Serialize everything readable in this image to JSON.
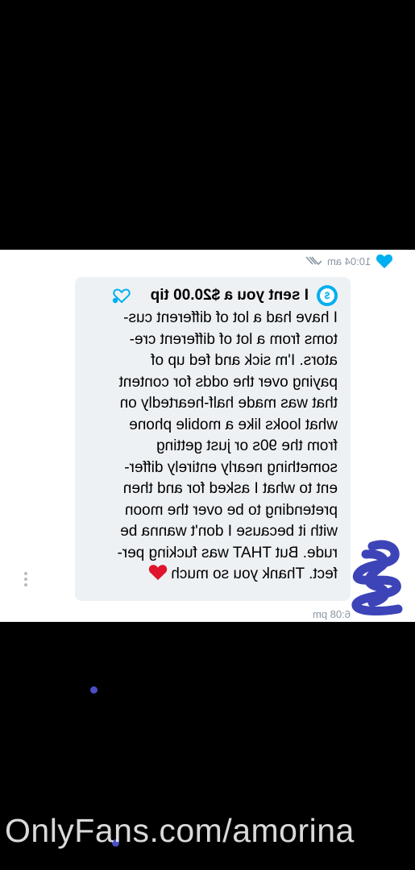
{
  "previous_message": {
    "timestamp": "10:04 am",
    "liked": true
  },
  "message": {
    "tip_label": "I sent you a $20.00 tip",
    "tip_icon": "dollar-circle-icon",
    "body": "I have had a lot of different cus-\ntoms from a lot of different cre-\nators. I'm sick and fed up of\npaying over the odds for content\nthat was made half-heartedly on\nwhat looks like a mobile phone\nfrom the 90s or just getting\nsomething nearly entirely differ-\nent to what I asked for and then\npretending to be over the moon\nwith it because I don't wanna be\nrude. But THAT was fucking per-\nfect. Thank you so much",
    "emoji": "red-heart-icon",
    "timestamp": "6:08 pm"
  },
  "colors": {
    "accent": "#00aff0",
    "bubble": "#eef1f4",
    "meta_text": "#8a96a3",
    "redaction": "#3d44b8"
  },
  "watermark": "OnlyFans.com/amorina"
}
